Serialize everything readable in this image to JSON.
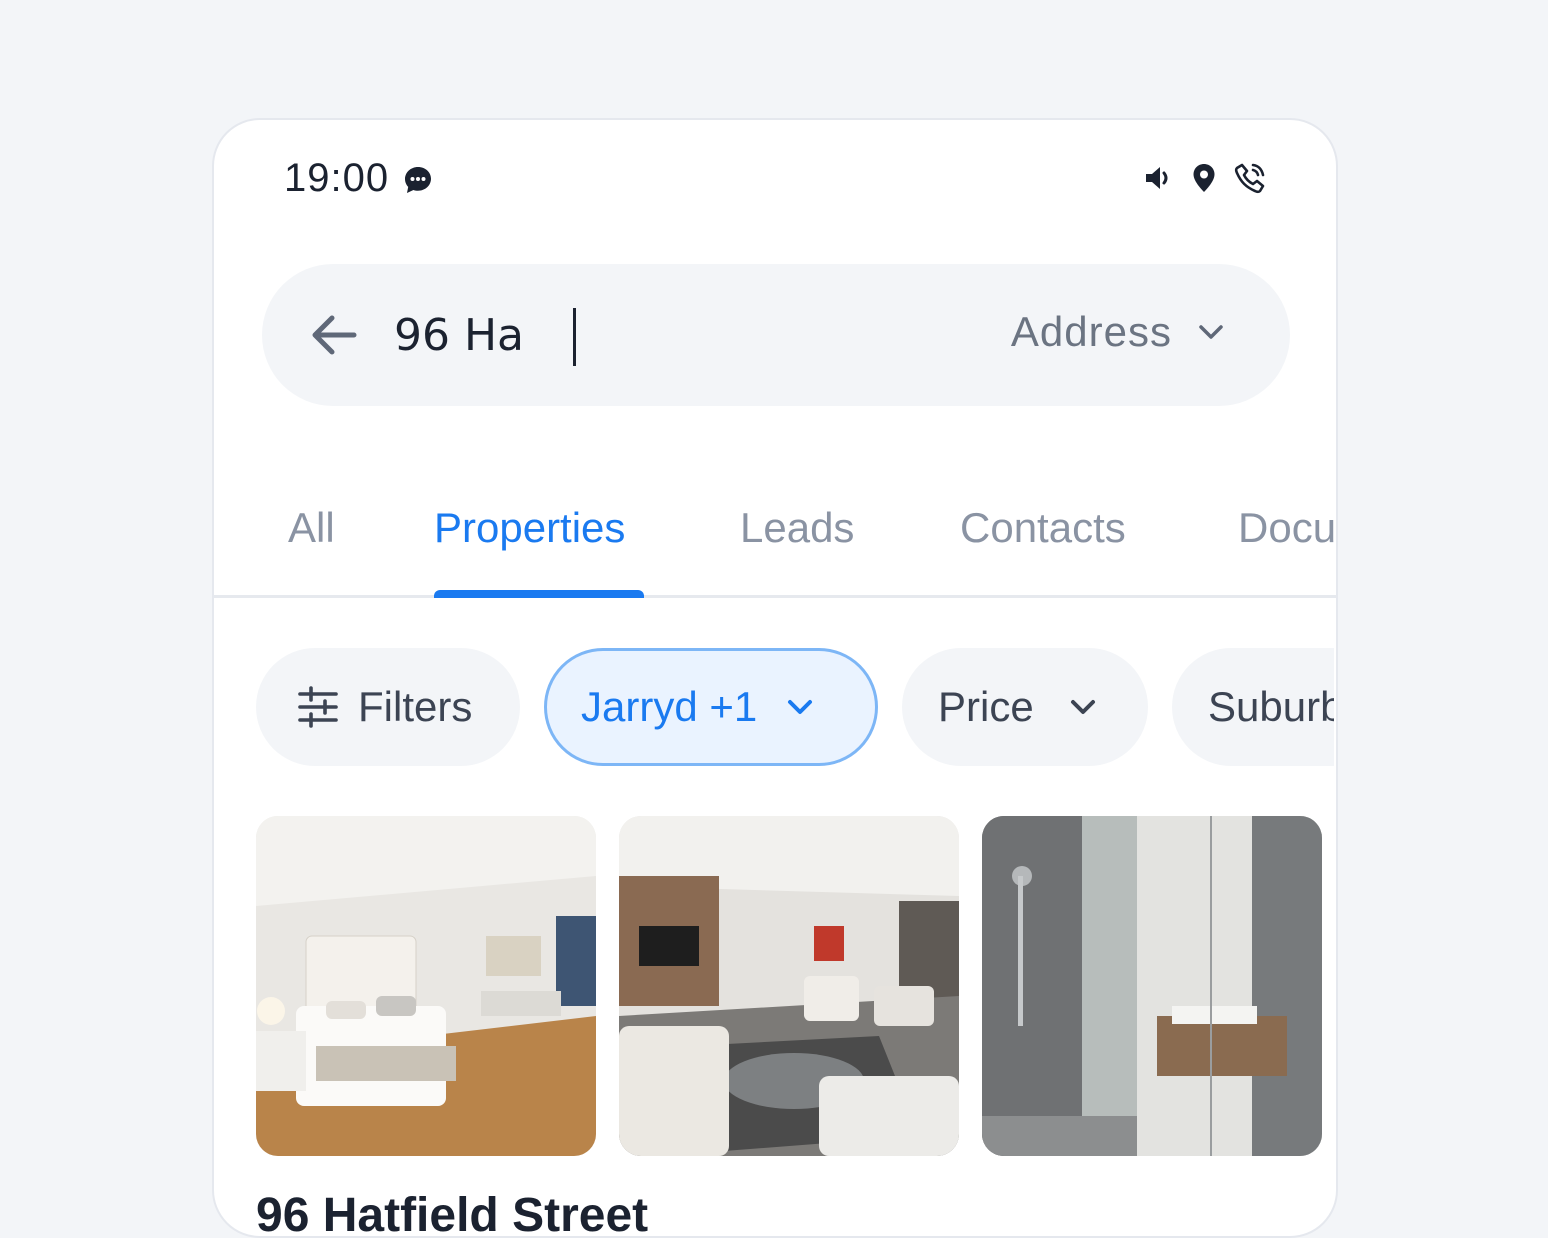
{
  "status_bar": {
    "time": "19:00",
    "icons": [
      "message-icon",
      "volume-icon",
      "location-icon",
      "call-icon"
    ]
  },
  "search": {
    "value": "96 Ha",
    "type_label": "Address"
  },
  "tabs": [
    {
      "label": "All",
      "active": false
    },
    {
      "label": "Properties",
      "active": true
    },
    {
      "label": "Leads",
      "active": false
    },
    {
      "label": "Contacts",
      "active": false
    },
    {
      "label": "Docu",
      "active": false
    }
  ],
  "chips": {
    "filters": "Filters",
    "agent": "Jarryd +1",
    "price": "Price",
    "suburb": "Suburb"
  },
  "listing": {
    "photos": [
      "bedroom-photo",
      "living-room-photo",
      "bathroom-photo"
    ],
    "title": "96 Hatfield Street"
  },
  "colors": {
    "accent": "#1a7af0",
    "active_chip_bg": "#eaf3ff",
    "active_chip_border": "#7db6f6",
    "surface": "#f3f5f8"
  }
}
